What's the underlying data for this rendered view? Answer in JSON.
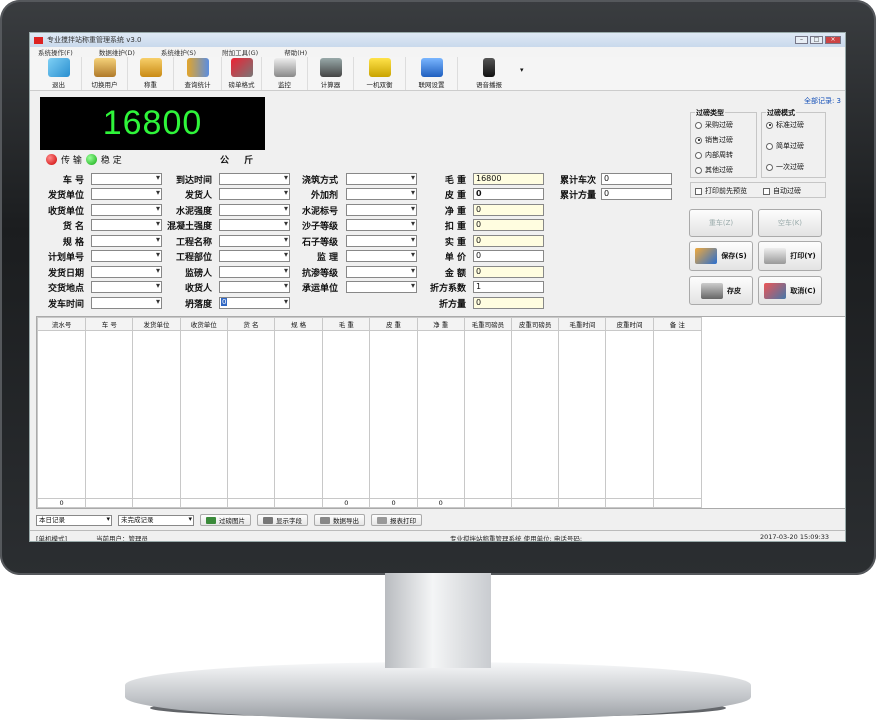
{
  "window": {
    "title": "专业搅拌站称重管理系统 v3.0"
  },
  "menu": [
    "系统操作(F)",
    "数据维护(D)",
    "系统维护(S)",
    "附加工具(G)",
    "帮助(H)"
  ],
  "toolbar": [
    {
      "label": "退出",
      "icon": "shoe-icon"
    },
    {
      "label": "切换用户",
      "icon": "users-icon"
    },
    {
      "label": "称重",
      "icon": "scale-icon"
    },
    {
      "label": "查询统计",
      "icon": "chart-icon"
    },
    {
      "label": "磅单格式",
      "icon": "tools-icon"
    },
    {
      "label": "监控",
      "icon": "camera-icon"
    },
    {
      "label": "计算器",
      "icon": "calculator-icon"
    },
    {
      "label": "一机双衡",
      "icon": "forklift-icon"
    },
    {
      "label": "联网设置",
      "icon": "network-icon"
    },
    {
      "label": "语音播报",
      "icon": "microphone-icon"
    }
  ],
  "all_records": "全部记录: 3",
  "weight_display": "16800",
  "status": {
    "transmit": "传 输",
    "stable": "稳 定",
    "unit": "公 斤"
  },
  "form": {
    "col1": [
      "车 号",
      "发货单位",
      "收货单位",
      "货 名",
      "规 格",
      "计划单号",
      "发货日期",
      "交货地点",
      "发车时间"
    ],
    "col2": [
      "到达时间",
      "发货人",
      "水泥强度",
      "混凝土强度",
      "工程名称",
      "工程部位",
      "监磅人",
      "收货人",
      "坍落度"
    ],
    "col3": [
      "浇筑方式",
      "外加剂",
      "水泥标号",
      "沙子等级",
      "石子等级",
      "监 理",
      "抗渗等级",
      "承运单位"
    ],
    "col4": [
      "毛 重",
      "皮 重",
      "净 重",
      "扣 重",
      "实 重",
      "单 价",
      "金 额",
      "折方系数",
      "折方量"
    ],
    "col4_values": [
      "16800",
      "0",
      "0",
      "0",
      "0",
      "0",
      "0",
      "1",
      "0"
    ],
    "slump_value": "0",
    "col5": [
      "累计车次",
      "累计方量"
    ],
    "col5_values": [
      "0",
      "0"
    ]
  },
  "weigh_type": {
    "title": "过磅类型",
    "options": [
      "采购过磅",
      "销售过磅",
      "内部周转",
      "其他过磅"
    ],
    "selected": "销售过磅"
  },
  "weigh_mode": {
    "title": "过磅模式",
    "options": [
      "标准过磅",
      "简单过磅",
      "一次过磅"
    ],
    "selected": "标准过磅"
  },
  "checks": [
    "打印前先预览",
    "自动过磅"
  ],
  "buttons": {
    "heavy": "重车(Z)",
    "empty": "空车(K)",
    "save": "保存(S)",
    "print": "打印(Y)",
    "tare": "存皮",
    "cancel": "取消(C)"
  },
  "table": {
    "columns": [
      "流水号",
      "车 号",
      "发货单位",
      "收货单位",
      "货 名",
      "规 格",
      "毛 重",
      "皮 重",
      "净 重",
      "毛重司磅员",
      "皮重司磅员",
      "毛重时间",
      "皮重时间",
      "备 注"
    ],
    "totals": [
      "0",
      "",
      "",
      "",
      "",
      "",
      "0",
      "0",
      "0",
      "",
      "",
      "",
      "",
      ""
    ]
  },
  "bottom": {
    "filter1": "本日记录",
    "filter2": "未完成记录",
    "btn_photo": "过磅图片",
    "btn_font": "显示字段",
    "btn_export": "数据导出",
    "btn_print": "报表打印"
  },
  "statusbar": {
    "mode": "[单机模式]",
    "user": "当前用户：管理员",
    "company": "专业搅拌站称重管理系统 使用单位: 电话号码:",
    "datetime": "2017-03-20 15:09:33"
  }
}
